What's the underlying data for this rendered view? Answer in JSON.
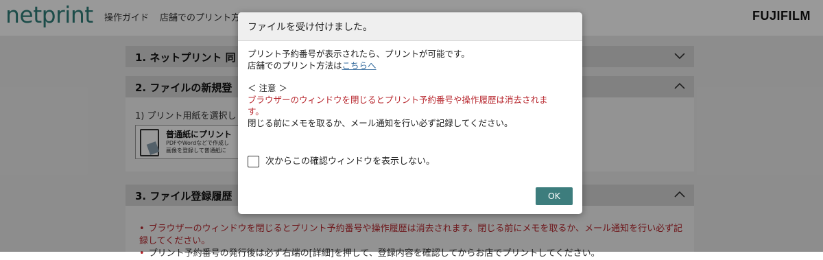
{
  "header": {
    "logo": "netprint",
    "nav": [
      "操作ガイド",
      "店舗でのプリント方法"
    ],
    "brand": "FUJIFILM"
  },
  "sections": [
    {
      "title": "1. ネットプリント 同",
      "arrow": "chevron-down-icon"
    },
    {
      "title": "2. ファイルの新規登",
      "arrow": "chevron-up-icon"
    },
    {
      "title": "3. ファイル登録履歴",
      "arrow": "chevron-up-icon"
    }
  ],
  "section2": {
    "step": "1) プリント用紙を選択し",
    "paper_title": "普通紙にプリント",
    "paper_desc_1": "PDFやWordなどで作成し",
    "paper_desc_2": "画像を登録して普通紙に"
  },
  "section3": {
    "notes": [
      "ブラウザーのウィンドウを閉じるとプリント予約番号や操作履歴は消去されます。閉じる前にメモを取るか、メール通知を行い必ず記録してください。",
      "プリント予約番号の発行後は必ず右端の[詳細]を押して、登録内容を確認してからお店でプリントしてください。"
    ]
  },
  "dialog": {
    "title": "ファイルを受け付けました。",
    "line1": "プリント予約番号が表示されたら、プリントが可能です。",
    "line2_prefix": "店舗でのプリント方法は",
    "line2_link": "こちらへ",
    "caution_heading": "＜ 注意 ＞",
    "caution_red_1": "ブラウザーのウィンドウを閉じるとプリント予約番号や操作履歴は消去されま",
    "caution_red_2": "す。",
    "caution_text": "閉じる前にメモを取るか、メール通知を行い必ず記録してください。",
    "checkbox_label": "次からこの確認ウィンドウを表示しない。",
    "checkbox_checked": false,
    "ok_label": "OK"
  },
  "colors": {
    "accent": "#3d7d7d",
    "warning": "#b8282f",
    "logo": "#2f7f7b"
  }
}
